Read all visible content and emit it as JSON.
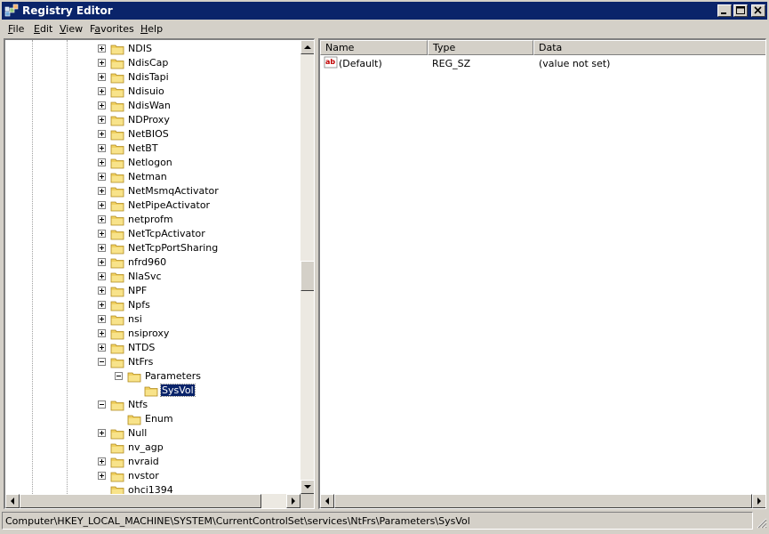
{
  "window": {
    "title": "Registry Editor"
  },
  "menu": [
    {
      "key": "F",
      "rest": "ile"
    },
    {
      "key": "E",
      "rest": "dit"
    },
    {
      "key": "V",
      "rest": "iew"
    },
    {
      "key": "",
      "pre": "F",
      "key2": "a",
      "rest": "vorites"
    },
    {
      "key": "H",
      "rest": "elp"
    }
  ],
  "tree": {
    "items": [
      {
        "label": "NDIS",
        "expander": "plus",
        "selected": false
      },
      {
        "label": "NdisCap",
        "expander": "plus",
        "selected": false
      },
      {
        "label": "NdisTapi",
        "expander": "plus",
        "selected": false
      },
      {
        "label": "Ndisuio",
        "expander": "plus",
        "selected": false
      },
      {
        "label": "NdisWan",
        "expander": "plus",
        "selected": false
      },
      {
        "label": "NDProxy",
        "expander": "plus",
        "selected": false
      },
      {
        "label": "NetBIOS",
        "expander": "plus",
        "selected": false
      },
      {
        "label": "NetBT",
        "expander": "plus",
        "selected": false
      },
      {
        "label": "Netlogon",
        "expander": "plus",
        "selected": false
      },
      {
        "label": "Netman",
        "expander": "plus",
        "selected": false
      },
      {
        "label": "NetMsmqActivator",
        "expander": "plus",
        "selected": false
      },
      {
        "label": "NetPipeActivator",
        "expander": "plus",
        "selected": false
      },
      {
        "label": "netprofm",
        "expander": "plus",
        "selected": false
      },
      {
        "label": "NetTcpActivator",
        "expander": "plus",
        "selected": false
      },
      {
        "label": "NetTcpPortSharing",
        "expander": "plus",
        "selected": false
      },
      {
        "label": "nfrd960",
        "expander": "plus",
        "selected": false
      },
      {
        "label": "NlaSvc",
        "expander": "plus",
        "selected": false
      },
      {
        "label": "NPF",
        "expander": "plus",
        "selected": false
      },
      {
        "label": "Npfs",
        "expander": "plus",
        "selected": false
      },
      {
        "label": "nsi",
        "expander": "plus",
        "selected": false
      },
      {
        "label": "nsiproxy",
        "expander": "plus",
        "selected": false
      },
      {
        "label": "NTDS",
        "expander": "plus",
        "selected": false
      },
      {
        "label": "NtFrs",
        "expander": "minus",
        "selected": false
      },
      {
        "label": "Parameters",
        "expander": "minus",
        "selected": false
      },
      {
        "label": "SysVol",
        "expander": "none",
        "selected": true
      },
      {
        "label": "Ntfs",
        "expander": "minus",
        "selected": false
      },
      {
        "label": "Enum",
        "expander": "none",
        "selected": false
      },
      {
        "label": "Null",
        "expander": "plus",
        "selected": false
      },
      {
        "label": "nv_agp",
        "expander": "none",
        "selected": false
      },
      {
        "label": "nvraid",
        "expander": "plus",
        "selected": false
      },
      {
        "label": "nvstor",
        "expander": "plus",
        "selected": false
      },
      {
        "label": "ohci1394",
        "expander": "none",
        "selected": false
      }
    ]
  },
  "list": {
    "columns": [
      "Name",
      "Type",
      "Data"
    ],
    "rows": [
      {
        "name": "(Default)",
        "type": "REG_SZ",
        "data": "(value not set)",
        "icon": "string-value-icon"
      }
    ]
  },
  "status": {
    "path": "Computer\\HKEY_LOCAL_MACHINE\\SYSTEM\\CurrentControlSet\\services\\NtFrs\\Parameters\\SysVol"
  },
  "colors": {
    "title_bar": "#0a246a",
    "selection": "#0a246a",
    "folder": "#f0d060",
    "chrome": "#d4d0c8"
  }
}
